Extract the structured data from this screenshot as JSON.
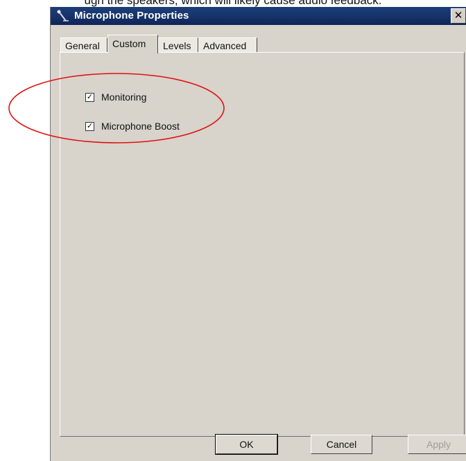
{
  "caption": {
    "text": "ugh the speakers, which will likely cause audio feedback."
  },
  "window": {
    "title": "Microphone Properties",
    "icon": "microphone-icon",
    "close_label": "✕"
  },
  "tabs": [
    {
      "label": "General",
      "active": false
    },
    {
      "label": "Custom",
      "active": true
    },
    {
      "label": "Levels",
      "active": false
    },
    {
      "label": "Advanced",
      "active": false
    }
  ],
  "options": [
    {
      "label": "Monitoring",
      "checked": true
    },
    {
      "label": "Microphone Boost",
      "checked": true
    }
  ],
  "buttons": {
    "ok": "OK",
    "cancel": "Cancel",
    "apply": "Apply"
  },
  "colors": {
    "titlebar": "#163269",
    "dialog_bg": "#d8d3cb",
    "annotation": "#e01010"
  }
}
